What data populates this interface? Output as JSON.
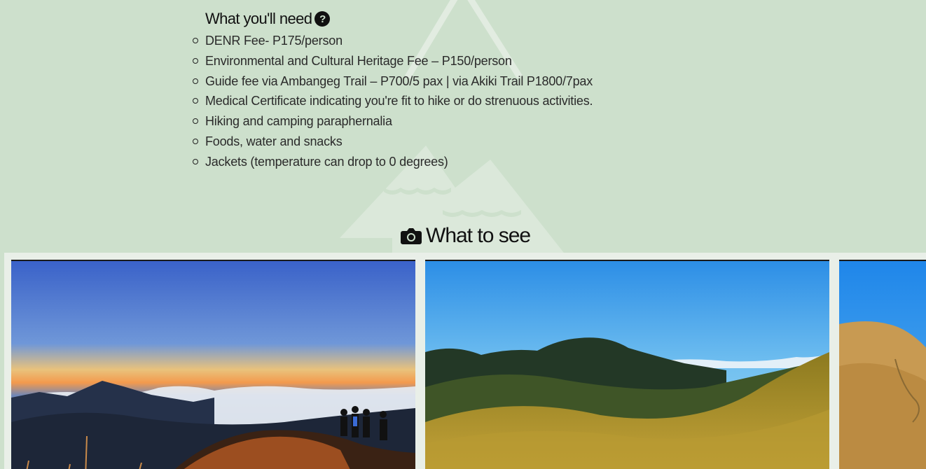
{
  "needs": {
    "title": "What you'll need",
    "help_glyph": "?",
    "items": [
      "DENR Fee- P175/person",
      "Environmental and Cultural Heritage Fee – P150/person",
      "Guide fee via Ambangeg Trail – P700/5 pax | via Akiki Trail P1800/7pax",
      "Medical Certificate indicating you're fit to hike or do strenuous activities.",
      "Hiking and camping paraphernalia",
      "Foods, water and snacks",
      "Jackets (temperature can drop to 0 degrees)"
    ]
  },
  "see": {
    "title": "What to see",
    "icon": "camera-icon"
  },
  "gallery": {
    "photos": [
      {
        "subject": "sunrise-sea-of-clouds-hikers"
      },
      {
        "subject": "grassy-mountain-ridge-blue-sky"
      },
      {
        "subject": "golden-grass-slopes"
      }
    ]
  },
  "colors": {
    "background": "#cde0cc",
    "watermark": "#e2ece1",
    "text": "#111111",
    "gallery_bg": "#e9efe8"
  }
}
